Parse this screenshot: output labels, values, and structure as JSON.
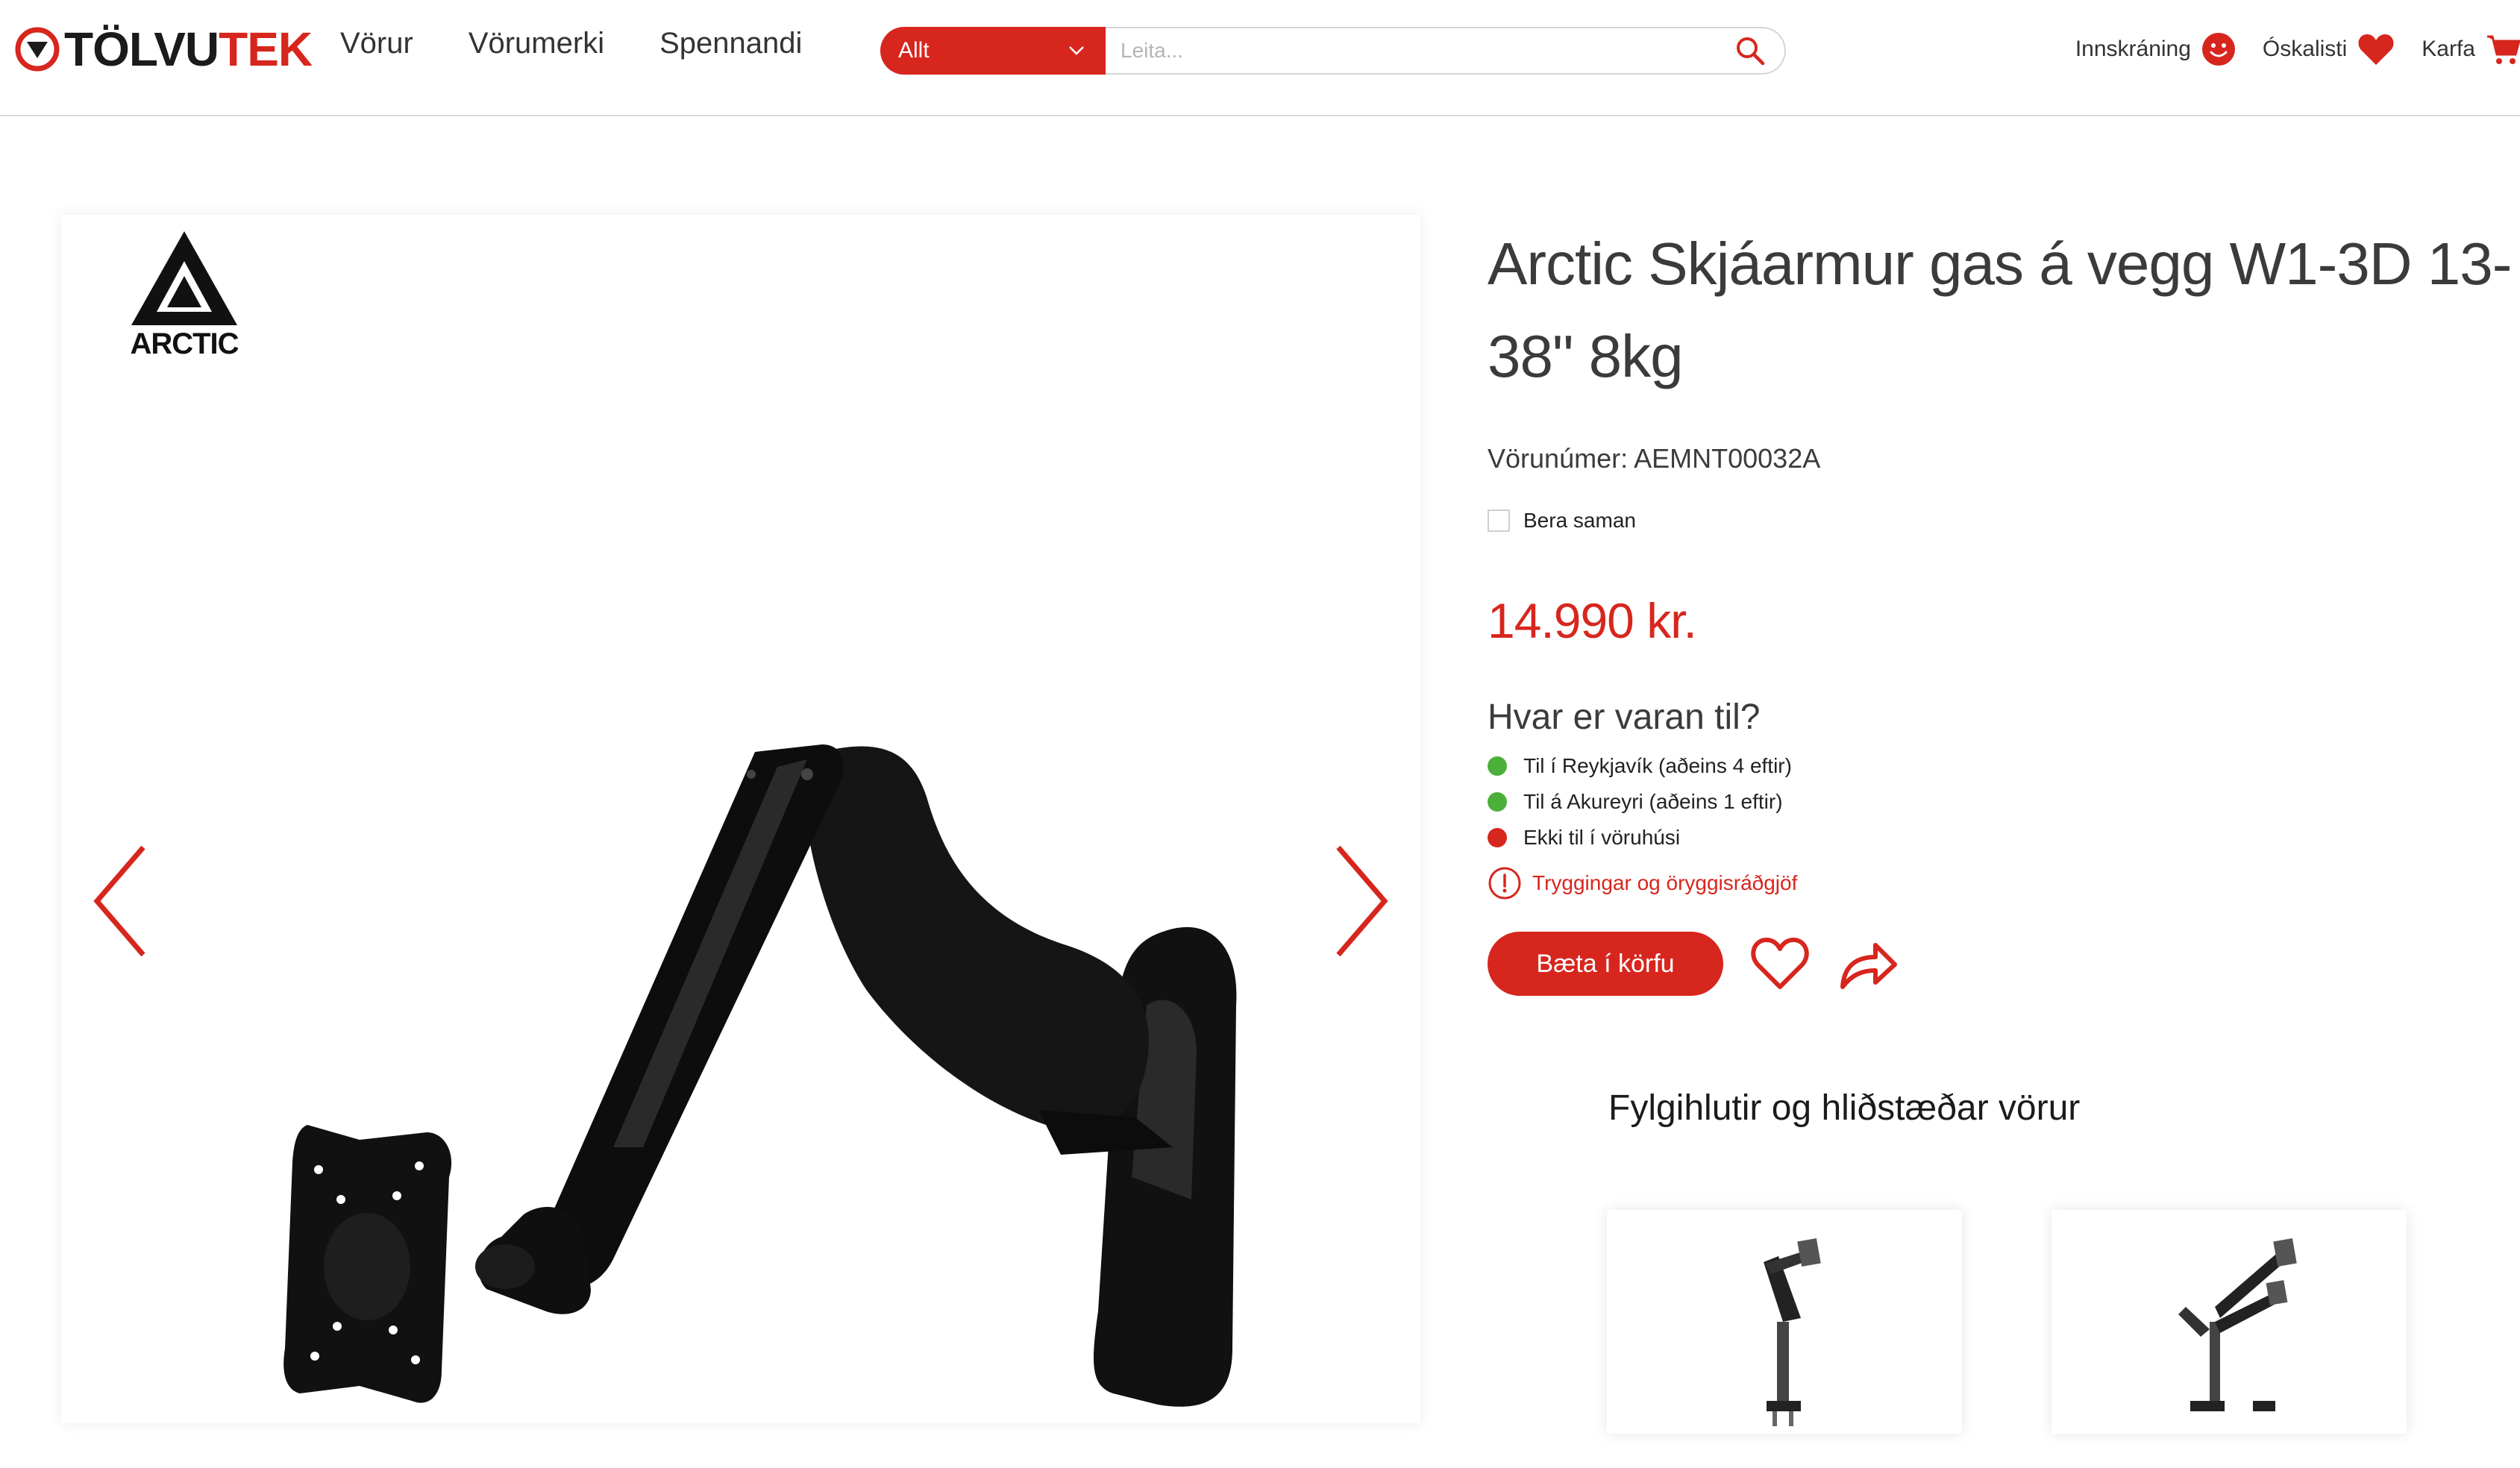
{
  "header": {
    "logo": {
      "text_part1": "TÖLVU",
      "text_part2": "TEK"
    },
    "nav": [
      {
        "label": "Vörur"
      },
      {
        "label": "Vörumerki"
      },
      {
        "label": "Spennandi"
      }
    ],
    "search": {
      "category": "Allt",
      "placeholder": "Leita..."
    },
    "links": {
      "login": "Innskráning",
      "wishlist": "Óskalisti",
      "cart": "Karfa"
    }
  },
  "gallery": {
    "brand_name": "ARCTIC"
  },
  "product": {
    "title": "Arctic Skjáarmur gas á vegg W1-3D 13-38\" 8kg",
    "sku": "Vörunúmer: AEMNT00032A",
    "compare_label": "Bera saman",
    "price": "14.990 kr.",
    "availability_title": "Hvar er varan til?",
    "stock": [
      {
        "label": "Til í Reykjavík (aðeins 4 eftir)",
        "status_color": "#4caf3a"
      },
      {
        "label": "Til á Akureyri (aðeins 1 eftir)",
        "status_color": "#4caf3a"
      },
      {
        "label": "Ekki til í vöruhúsi",
        "status_color": "#d7261e"
      }
    ],
    "safety_link": "Tryggingar og öryggisráðgjöf",
    "add_to_cart": "Bæta í körfu"
  },
  "related": {
    "title": "Fylgihlutir og hliðstæðar vörur"
  },
  "colors": {
    "brand_red": "#d7261e",
    "text_dark": "#3b3b3b"
  }
}
